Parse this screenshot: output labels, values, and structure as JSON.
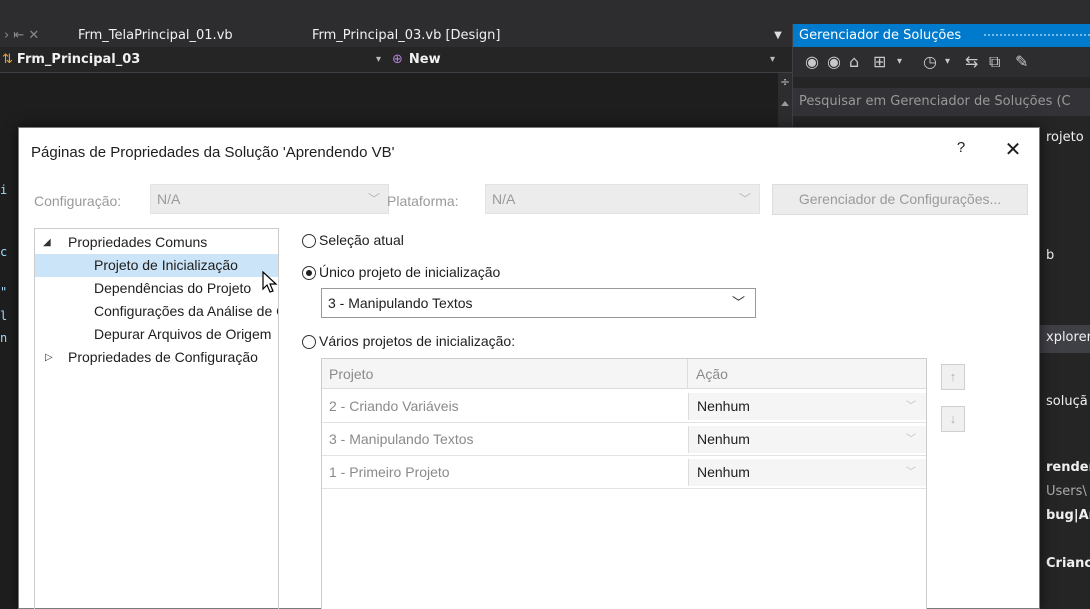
{
  "ide": {
    "tabs": [
      {
        "label": "Frm_TelaPrincipal_01.vb"
      },
      {
        "label": "Frm_Principal_03.vb [Design]"
      }
    ],
    "nav_left": "Frm_Principal_03",
    "nav_right": "New",
    "gutter_marks": [
      "i",
      "c",
      "\"",
      "l",
      "n"
    ]
  },
  "solution_explorer": {
    "title": "Gerenciador de Soluções",
    "search_placeholder": "Pesquisar em Gerenciador de Soluções (C",
    "fragments": [
      "rojeto",
      "b",
      "xplorer",
      "soluçã",
      "render",
      "Users\\",
      "bug|Ar",
      "Crianc"
    ]
  },
  "dialog": {
    "title": "Páginas de Propriedades da Solução 'Aprendendo VB'",
    "help": "?",
    "close": "✕",
    "config_label": "Configuração:",
    "config_value": "N/A",
    "platform_label": "Plataforma:",
    "platform_value": "N/A",
    "config_manager_button": "Gerenciador de Configurações...",
    "tree": {
      "common": "Propriedades Comuns",
      "items": [
        "Projeto de Inicialização",
        "Dependências do Projeto",
        "Configurações da Análise de Código",
        "Depurar Arquivos de Origem"
      ],
      "config": "Propriedades de Configuração"
    },
    "startup": {
      "current_selection": "Seleção atual",
      "single_startup": "Único projeto de inicialização",
      "single_value": "3 - Manipulando Textos",
      "multiple_startup": "Vários projetos de inicialização:"
    },
    "grid": {
      "col_project": "Projeto",
      "col_action": "Ação",
      "rows": [
        {
          "project": "2 - Criando Variáveis",
          "action": "Nenhum"
        },
        {
          "project": "3 - Manipulando Textos",
          "action": "Nenhum"
        },
        {
          "project": "1 - Primeiro Projeto",
          "action": "Nenhum"
        }
      ]
    },
    "move_up": "↑",
    "move_down": "↓"
  }
}
